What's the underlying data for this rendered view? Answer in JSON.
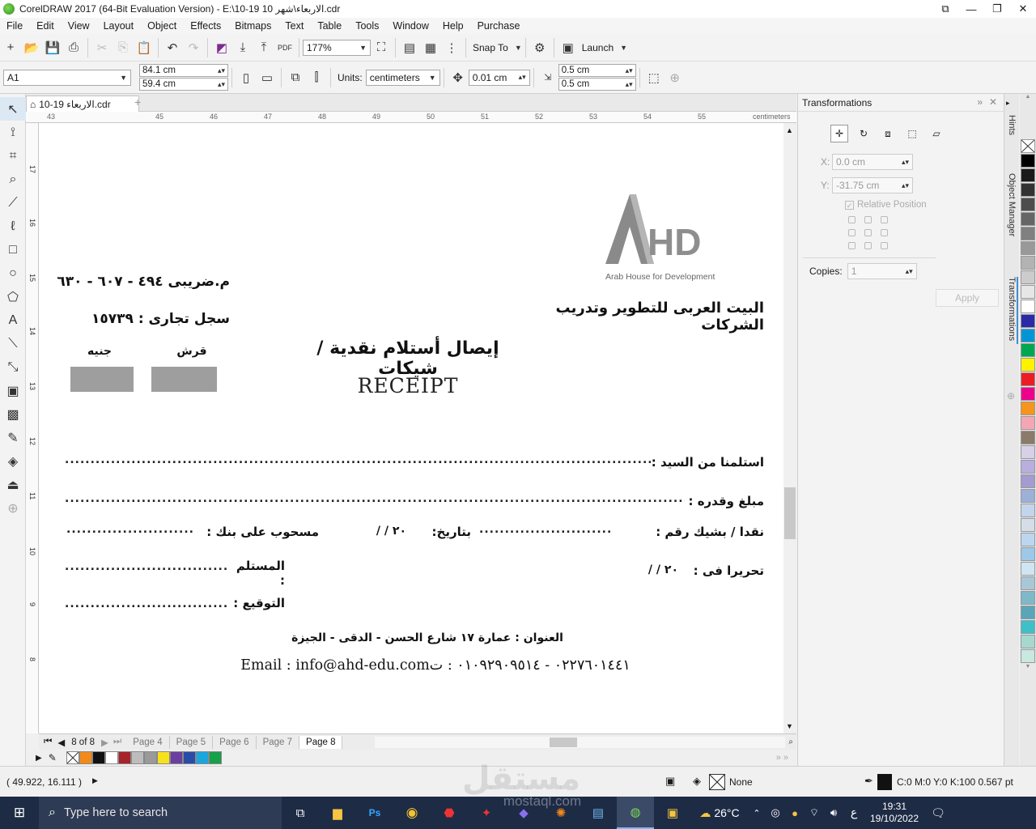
{
  "window": {
    "title": "CorelDRAW 2017 (64-Bit Evaluation Version) - E:\\10-19 الاربعاء\\شهر 10.cdr"
  },
  "menu": [
    "File",
    "Edit",
    "View",
    "Layout",
    "Object",
    "Effects",
    "Bitmaps",
    "Text",
    "Table",
    "Tools",
    "Window",
    "Help",
    "Purchase"
  ],
  "toolbar1": {
    "zoom": "177%",
    "snap_label": "Snap To",
    "launch_label": "Launch"
  },
  "toolbar2": {
    "page_size": "A1",
    "width": "84.1 cm",
    "height": "59.4 cm",
    "units_label": "Units:",
    "units_value": "centimeters",
    "nudge": "0.01 cm",
    "dup_x": "0.5 cm",
    "dup_y": "0.5 cm"
  },
  "doc_tab": "10-19 الاربعاء.cdr",
  "ruler": {
    "h_ticks": [
      "43",
      "45",
      "46",
      "47",
      "48",
      "49",
      "50",
      "51",
      "52",
      "53",
      "54",
      "55"
    ],
    "h_unit": "centimeters",
    "v_ticks": [
      "17",
      "16",
      "15",
      "14",
      "13",
      "12",
      "11",
      "10",
      "9",
      "8"
    ]
  },
  "receipt": {
    "logo_text": "HD",
    "logo_sub": "Arab House for Development",
    "company": "البيت العربى للتطوير وتدريب الشركات",
    "tax_no": "م.ضريبى ٤٩٤ - ٦٠٧ - ٦٣٠",
    "commercial_reg": "سجل تجارى : ١٥٧٣٩",
    "currency_pound": "جنيه",
    "currency_piaster": "قرش",
    "title_ar": "إيصال أستلام نقدية / شيكات",
    "title_en": "RECEIPT",
    "line_received_from": "استلمنا من السيد :",
    "line_amount": "مبلغ وقدره :",
    "line_cash_check": "نقدا / بشيك رقم :",
    "line_date": "بتاريخ:",
    "date_tpl": "٢٠  /  /",
    "line_bank": "مسحوب على بنك :",
    "line_written_in": "تحريرا فى :",
    "written_date": "٢٠   /   /",
    "line_receiver": "المستلم :",
    "line_signature": "التوقيع :",
    "address": "العنوان : عمارة ١٧ شارع الحسن - الدقى - الجيزة",
    "contact": "Email : info@ahd-edu.com٠٢٢٧٦٠١٤٤١ - ٠١٠٩٢٩٠٩٥١٤ : ت",
    "dots_long": "............................................................................................................................",
    "dots_mid": ".............................................................................................................................................................",
    "dots_short": ".......................................",
    "dots_pre": "..........................",
    "dots_bank": "................................"
  },
  "pagebar": {
    "position": "8 of 8",
    "tabs": [
      "Page 4",
      "Page 5",
      "Page 6",
      "Page 7",
      "Page 8"
    ]
  },
  "docker": {
    "title": "Transformations",
    "x_label": "X:",
    "x_value": "0.0 cm",
    "y_label": "Y:",
    "y_value": "-31.75 cm",
    "relative_position": "Relative Position",
    "copies_label": "Copies:",
    "copies_value": "1",
    "apply_label": "Apply"
  },
  "docker_tabs": [
    "Hints",
    "Object Manager",
    "Transformations"
  ],
  "status": {
    "coords": "( 49.922, 16.111 )",
    "fill_none": "None",
    "outline": "C:0 M:0 Y:0 K:100  0.567 pt"
  },
  "taskbar": {
    "search_placeholder": "Type here to search",
    "weather": "26°C",
    "lang": "ع",
    "time": "19:31",
    "date": "19/10/2022"
  },
  "watermark": {
    "brand": "مستقل",
    "url": "mostaql.com"
  },
  "colors": {
    "accent": "#3c8fd6",
    "taskbar": "#1e2b45",
    "receipt_gray": "#9e9e9e"
  }
}
